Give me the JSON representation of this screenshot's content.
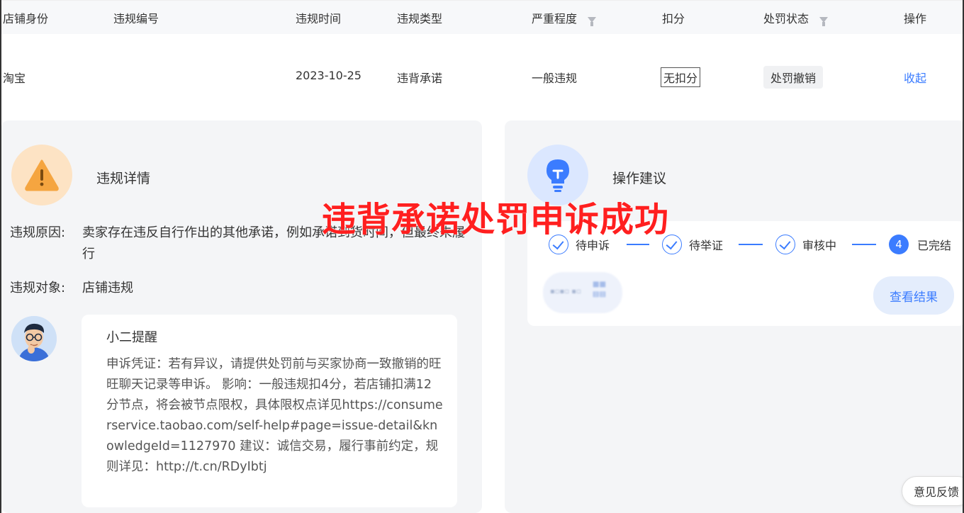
{
  "table": {
    "headers": {
      "store_identity": "店铺身份",
      "violation_no": "违规编号",
      "violation_time": "违规时间",
      "violation_type": "违规类型",
      "severity": "严重程度",
      "deduction": "扣分",
      "penalty_status": "处罚状态",
      "action": "操作"
    },
    "row": {
      "store_identity": "淘宝",
      "violation_no": "",
      "violation_time": "2023-10-25",
      "violation_type": "违背承诺",
      "severity": "一般违规",
      "deduction": "无扣分",
      "penalty_status": "处罚撤销",
      "action": "收起"
    }
  },
  "left_panel": {
    "title": "违规详情",
    "reason_label": "违规原因:",
    "reason_value": "卖家存在违反自行作出的其他承诺，例如承诺到货时间，但最终未履行",
    "target_label": "违规对象:",
    "target_value": "店铺违规",
    "tip": {
      "title": "小二提醒",
      "body": "申诉凭证：若有异议，请提供处罚前与买家协商一致撤销的旺旺聊天记录等申诉。 影响：一般违规扣4分，若店铺扣满12分节点，将会被节点限权，具体限权点详见https://consumerservice.taobao.com/self-help#page=issue-detail&knowledgeId=1127970 建议：诚信交易，履行事前约定，规则详见：http://t.cn/RDyIbtj"
    }
  },
  "right_panel": {
    "title": "操作建议",
    "steps": [
      {
        "label": "待申诉",
        "state": "done"
      },
      {
        "label": "待举证",
        "state": "done"
      },
      {
        "label": "审核中",
        "state": "done"
      },
      {
        "label": "已完结",
        "state": "current",
        "number": "4"
      }
    ],
    "view_result": "查看结果"
  },
  "overlay_caption": "违背承诺处罚申诉成功",
  "feedback": "意见反馈",
  "colors": {
    "accent": "#3b7cff",
    "overlay_red": "#ff1f1f",
    "warning_bg": "#fde3c4",
    "warning_icon": "#f5a540"
  }
}
